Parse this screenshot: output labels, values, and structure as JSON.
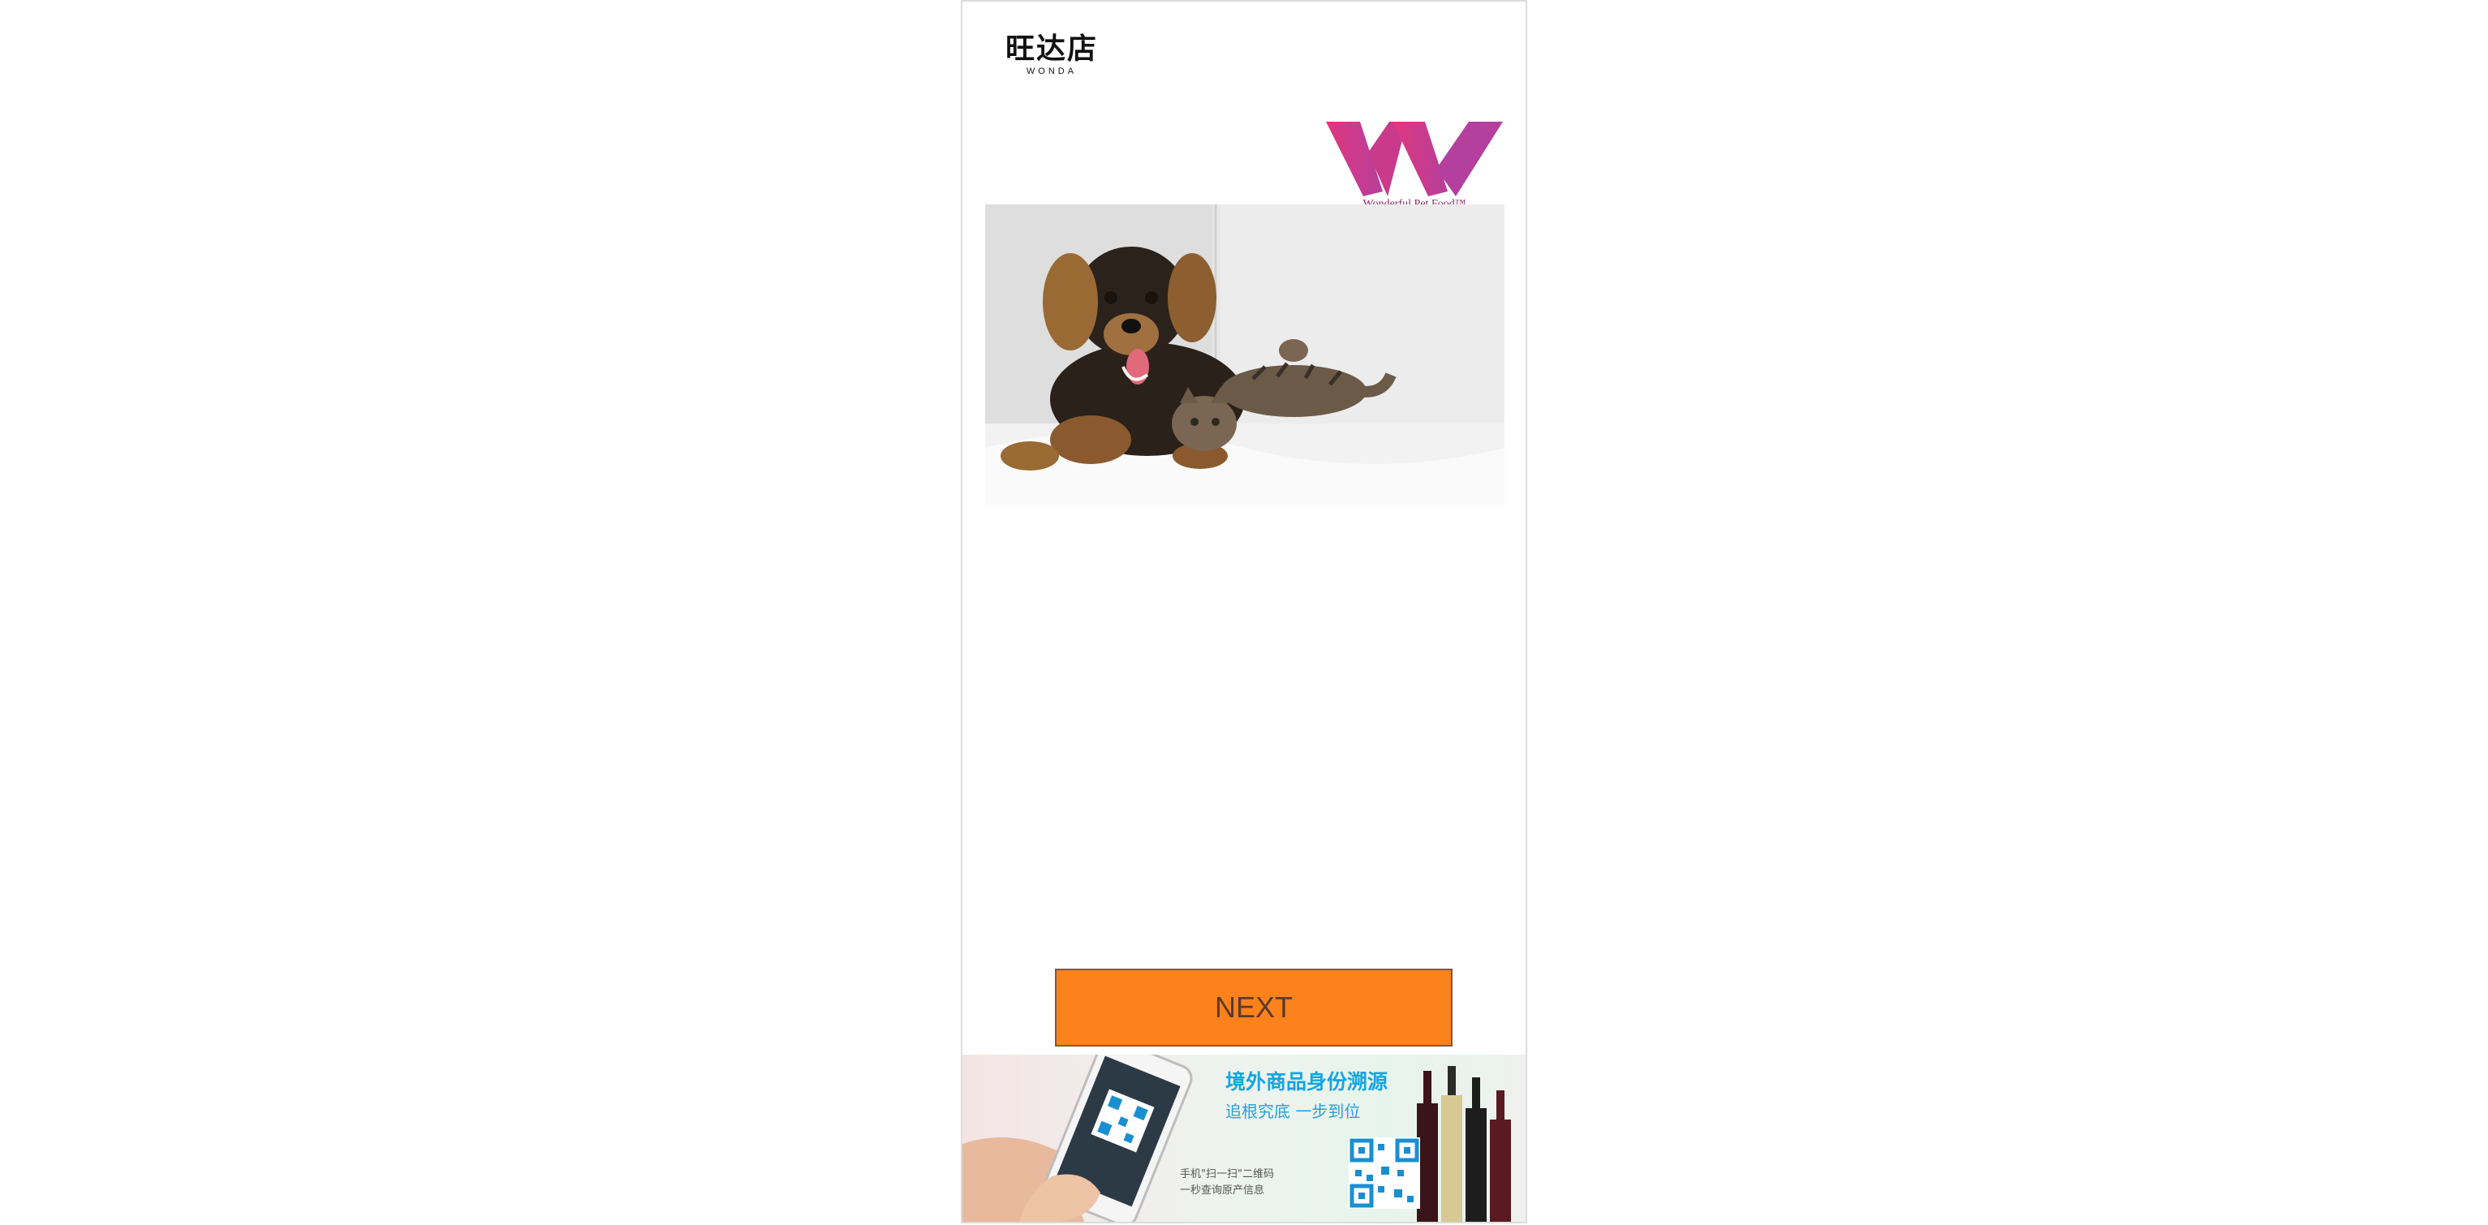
{
  "header": {
    "store_logo_cn": "旺达店",
    "store_logo_en": "WONDA"
  },
  "brand": {
    "tagline": "Wonderful Pet Food™",
    "logo_color_start": "#e0377e",
    "logo_color_end": "#9a3fa4"
  },
  "hero": {
    "image": "dog-and-cat-on-sofa"
  },
  "actions": {
    "next_label": "NEXT",
    "next_color": "#fd821b"
  },
  "banner": {
    "title": "境外商品身份溯源",
    "subtitle": "追根究底 一步到位",
    "note_line1": "手机\"扫一扫\"二维码",
    "note_line2": "一秒查询原产信息",
    "accent_color": "#14a6e0"
  }
}
